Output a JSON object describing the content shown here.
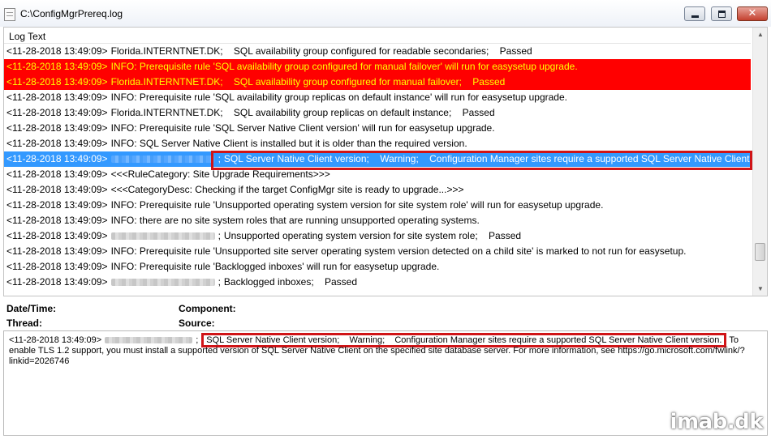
{
  "window": {
    "title": "C:\\ConfigMgrPrereq.log"
  },
  "log": {
    "column_header": "Log Text",
    "rows": [
      {
        "kind": "normal",
        "ts": "<11-28-2018 13:49:09>",
        "msg": "Florida.INTERNTNET.DK;    SQL availability group configured for readable secondaries;    Passed"
      },
      {
        "kind": "error",
        "ts": "<11-28-2018 13:49:09>",
        "msg": "INFO: Prerequisite rule 'SQL availability group configured for manual failover' will run for easysetup upgrade."
      },
      {
        "kind": "error",
        "ts": "<11-28-2018 13:49:09>",
        "msg": "Florida.INTERNTNET.DK;    SQL availability group configured for manual failover;    Passed"
      },
      {
        "kind": "normal",
        "ts": "<11-28-2018 13:49:09>",
        "msg": "INFO: Prerequisite rule 'SQL availability group replicas on default instance' will run for easysetup upgrade."
      },
      {
        "kind": "normal",
        "ts": "<11-28-2018 13:49:09>",
        "msg": "Florida.INTERNTNET.DK;    SQL availability group replicas on default instance;    Passed"
      },
      {
        "kind": "normal",
        "ts": "<11-28-2018 13:49:09>",
        "msg": "INFO: Prerequisite rule 'SQL Server Native Client version' will run for easysetup upgrade."
      },
      {
        "kind": "normal",
        "ts": "<11-28-2018 13:49:09>",
        "msg": "INFO: SQL Server Native Client is installed but it is older than the required version."
      },
      {
        "kind": "selected",
        "ts": "<11-28-2018 13:49:09>",
        "blur": 128,
        "msg": "SQL Server Native Client version;    Warning;    Configuration Manager sites require a supported SQL Server Native Client v..."
      },
      {
        "kind": "normal",
        "ts": "<11-28-2018 13:49:09>",
        "msg": "<<<RuleCategory: Site Upgrade Requirements>>>"
      },
      {
        "kind": "normal",
        "ts": "<11-28-2018 13:49:09>",
        "msg": "<<<CategoryDesc: Checking if the target ConfigMgr site is ready to upgrade...>>>"
      },
      {
        "kind": "normal",
        "ts": "<11-28-2018 13:49:09>",
        "msg": "INFO: Prerequisite rule 'Unsupported operating system version for site system role' will run for easysetup upgrade."
      },
      {
        "kind": "normal",
        "ts": "<11-28-2018 13:49:09>",
        "msg": "INFO: there are no site system roles that are running unsupported operating systems."
      },
      {
        "kind": "normal",
        "ts": "<11-28-2018 13:49:09>",
        "blur": 128,
        "msg": "Unsupported operating system version for site system role;    Passed"
      },
      {
        "kind": "normal",
        "ts": "<11-28-2018 13:49:09>",
        "msg": "INFO: Prerequisite rule 'Unsupported site server operating system version detected on a child site' is marked to not run for easysetup."
      },
      {
        "kind": "normal",
        "ts": "<11-28-2018 13:49:09>",
        "msg": "INFO: Prerequisite rule 'Backlogged inboxes' will run for easysetup upgrade."
      },
      {
        "kind": "normal",
        "ts": "<11-28-2018 13:49:09>",
        "blur": 128,
        "msg": "Backlogged inboxes;    Passed"
      }
    ]
  },
  "details": {
    "datetime_label": "Date/Time:",
    "component_label": "Component:",
    "thread_label": "Thread:",
    "source_label": "Source:"
  },
  "message": {
    "ts": "<11-28-2018 13:49:09>",
    "highlight": "SQL Server Native Client version;    Warning;    Configuration Manager sites require a supported SQL Server Native Client version.",
    "rest": " To enable TLS 1.2 support, you must install a supported version of SQL Server Native Client on the specified site database server. For more information, see https://go.microsoft.com/fwlink/?linkid=2026746"
  },
  "watermark": "imab.dk"
}
